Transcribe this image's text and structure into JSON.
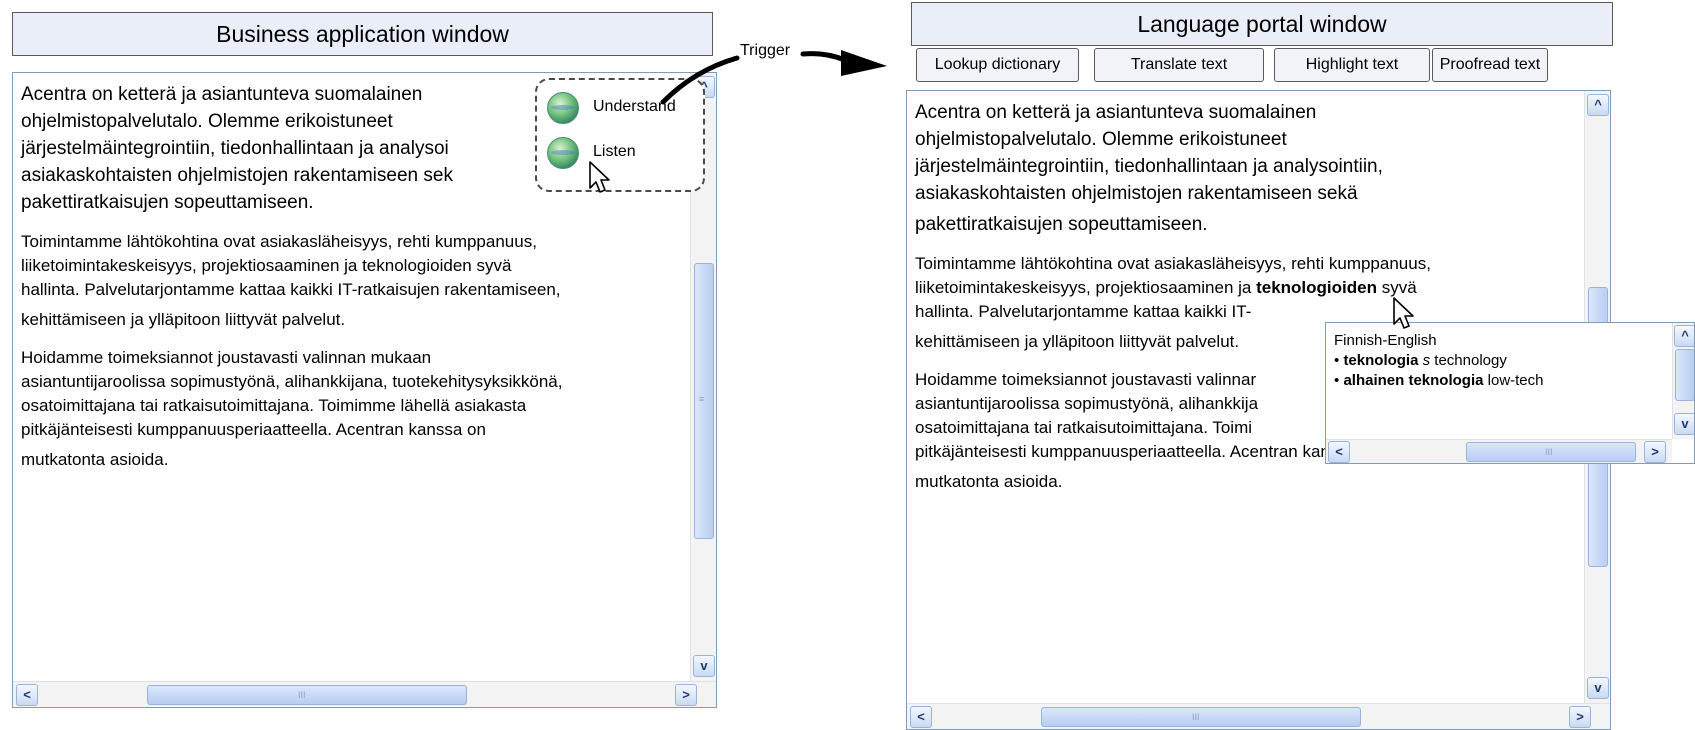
{
  "left_window": {
    "title": "Business application window",
    "text": {
      "p1": [
        "Acentra on ketterä ja asiantunteva suomalainen",
        "ohjelmistopalvelutalo. Olemme erikoistuneet",
        "järjestelmäintegrointiin, tiedonhallintaan ja analysoi",
        "asiakaskohtaisten ohjelmistojen rakentamiseen sek",
        "pakettiratkaisujen sopeuttamiseen."
      ],
      "p2": [
        "Toimintamme lähtökohtina ovat asiakasläheisyys, rehti kumppanuus,",
        "liiketoimintakeskeisyys, projektiosaaminen ja teknologioiden syvä",
        "hallinta. Palvelutarjontamme kattaa kaikki IT-ratkaisujen rakentamiseen,",
        "kehittämiseen ja ylläpitoon liittyvät palvelut."
      ],
      "p3": [
        "Hoidamme toimeksiannot joustavasti valinnan mukaan",
        "asiantuntijaroolissa sopimustyönä, alihankkijana, tuotekehitysyksikkönä,",
        "osatoimittajana tai ratkaisutoimittajana. Toimimme lähellä asiakasta",
        "pitkäjänteisesti kumppanuusperiaatteella. Acentran kanssa on",
        "mutkatonta asioida."
      ]
    },
    "popup": {
      "item1": "Understand",
      "item2": "Listen"
    }
  },
  "trigger_label": "Trigger",
  "right_window": {
    "title": "Language portal window",
    "buttons": [
      "Lookup dictionary",
      "Translate text",
      "Highlight text",
      "Proofread text"
    ],
    "text": {
      "p1": [
        "Acentra on ketterä ja asiantunteva suomalainen",
        "ohjelmistopalvelutalo. Olemme erikoistuneet",
        "järjestelmäintegrointiin, tiedonhallintaan ja analysointiin,",
        "asiakaskohtaisten ohjelmistojen rakentamiseen sekä",
        "pakettiratkaisujen sopeuttamiseen."
      ],
      "p2_line1": "Toimintamme lähtökohtina ovat asiakasläheisyys, rehti kumppanuus,",
      "p2_line2_a": "liiketoimintakeskeisyys, projektiosaaminen ja ",
      "p2_line2_bold": "teknologioiden",
      "p2_line2_b": " syvä",
      "p2_line3": "hallinta. Palvelutarjontamme kattaa kaikki IT-",
      "p2_line4": "kehittämiseen ja ylläpitoon liittyvät palvelut.",
      "p3": [
        "Hoidamme toimeksiannot joustavasti valinnar",
        "asiantuntijaroolissa sopimustyönä, alihankkija",
        "osatoimittajana tai ratkaisutoimittajana. Toimi",
        "pitkäjänteisesti kumppanuusperiaatteella. Acentran kanssa on",
        "mutkatonta asioida."
      ]
    },
    "tooltip": {
      "header": "Finnish-English",
      "entry1_bold": "teknologia",
      "entry1_pos": "s",
      "entry1_trans": "technology",
      "entry2_bold": "alhainen teknologia",
      "entry2_trans": "low-tech",
      "bullet": "•"
    }
  },
  "scroll": {
    "up": "^",
    "down": "v",
    "left": "<",
    "right": ">",
    "grip": "III"
  },
  "icons": [
    "globe-icon",
    "mouse-cursor-icon",
    "arrow-icon"
  ]
}
